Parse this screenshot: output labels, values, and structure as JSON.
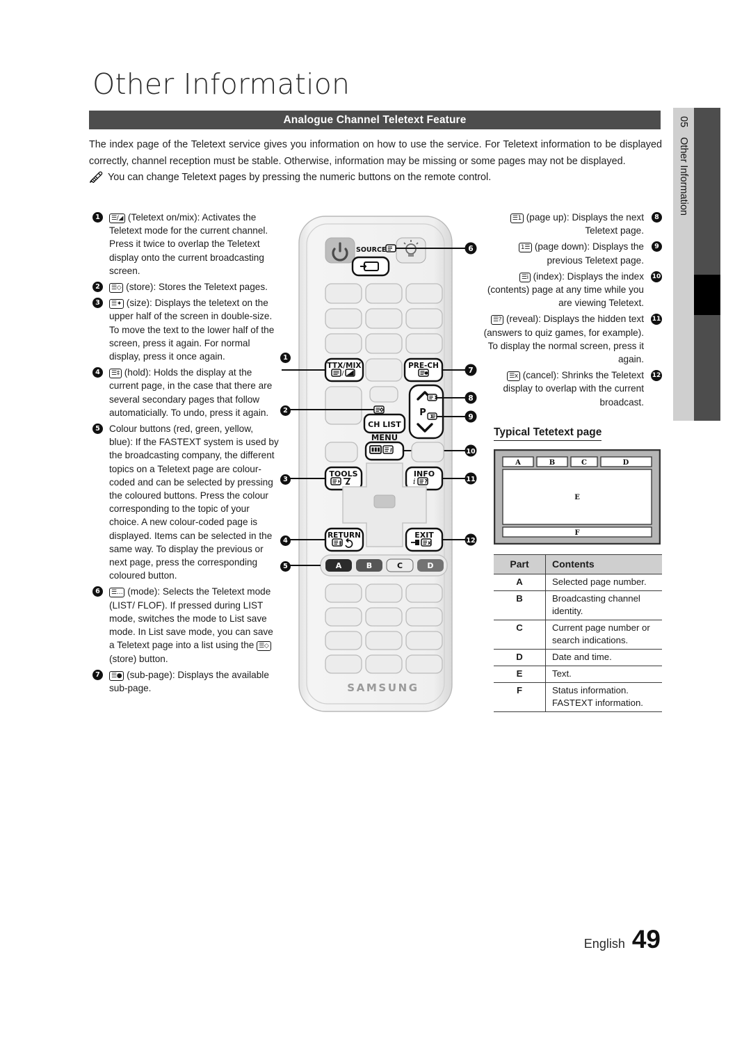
{
  "document": {
    "title": "Other Information",
    "section_header": "Analogue Channel Teletext Feature",
    "intro": "The index page of the Teletext service gives you information on how to use the service. For Teletext information to be displayed correctly, channel reception must be stable. Otherwise, information may be missing or some pages may not be displayed.",
    "note": "You can change Teletext pages by pressing the numeric buttons on the remote control.",
    "note_icon": "pencil-icon"
  },
  "left_column": [
    {
      "number": "1",
      "key": "☰/◢",
      "text": "(Teletext on/mix): Activates the Teletext mode for the current channel. Press it twice to overlap the Teletext display onto the current broadcasting screen."
    },
    {
      "number": "2",
      "key": "☰◇",
      "text": "(store): Stores the Teletext pages."
    },
    {
      "number": "3",
      "key": "☰✦",
      "text": "(size): Displays the teletext on the upper half of the screen in double-size. To move the text to the lower half of the screen, press it again. For normal display, press it once again."
    },
    {
      "number": "4",
      "key": "☰‡",
      "text": "(hold): Holds the display at the current page, in the case that there are several secondary pages that follow automaticially. To undo, press it again."
    },
    {
      "number": "5",
      "key": "",
      "text": "Colour buttons (red, green, yellow, blue): If the FASTEXT system is used by the broadcasting company, the different topics on a Teletext page are colour-coded and can be selected by pressing the coloured buttons. Press the colour corresponding to the topic of your choice. A new colour-coded page is displayed. Items can be selected in the same way. To display the previous or next page, press the corresponding coloured button."
    },
    {
      "number": "6",
      "key": "☰…",
      "text": "(mode): Selects the Teletext mode (LIST/ FLOF).",
      "text2_pre": "If pressed during LIST mode, switches the mode to List save mode. In List save mode, you can save a Teletext page into a list using the ",
      "text2_key": "☰◇",
      "text2_post": "(store) button."
    },
    {
      "number": "7",
      "key": "☰●",
      "text": "(sub-page): Displays the available sub-page."
    }
  ],
  "right_column": [
    {
      "number": "8",
      "key": "☰1",
      "text": "(page up): Displays the next Teletext page."
    },
    {
      "number": "9",
      "key": "1☰",
      "text": "(page down): Displays the previous Teletext page."
    },
    {
      "number": "10",
      "key": "☰i",
      "text": "(index): Displays the index (contents) page at any time while you are viewing Teletext."
    },
    {
      "number": "11",
      "key": "☰?",
      "text": "(reveal): Displays the hidden text (answers to quiz games, for example). To display the normal screen, press it again."
    },
    {
      "number": "12",
      "key": "☰x",
      "text": "(cancel): Shrinks the Teletext display to overlap with the current broadcast."
    }
  ],
  "remote": {
    "brand": "SAMSUNG",
    "buttons": {
      "source_label": "SOURCE",
      "ttxmix": "TTX/MIX",
      "prech": "PRE-CH",
      "chlist": "CH LIST",
      "menu": "MENU",
      "tools": "TOOLS",
      "info": "INFO",
      "return": "RETURN",
      "exit": "EXIT",
      "p_label": "P",
      "colour_a": "A",
      "colour_b": "B",
      "colour_c": "C",
      "colour_d": "D"
    },
    "callouts_left": [
      "1",
      "2",
      "3",
      "4",
      "5"
    ],
    "callouts_right": [
      "6",
      "7",
      "8",
      "9",
      "10",
      "11",
      "12"
    ]
  },
  "teletext_page": {
    "title": "Typical Tetetext page",
    "regions": [
      "A",
      "B",
      "C",
      "D",
      "E",
      "F"
    ]
  },
  "table": {
    "headers": [
      "Part",
      "Contents"
    ],
    "rows": [
      {
        "part": "A",
        "contents": "Selected page number."
      },
      {
        "part": "B",
        "contents": "Broadcasting channel identity."
      },
      {
        "part": "C",
        "contents": "Current page number or search indications."
      },
      {
        "part": "D",
        "contents": "Date and time."
      },
      {
        "part": "E",
        "contents": "Text."
      },
      {
        "part": "F",
        "contents": "Status information. FASTEXT information."
      }
    ]
  },
  "side_tab": {
    "chapter_number": "05",
    "chapter_title": "Other Information"
  },
  "footer": {
    "language": "English",
    "page_number": "49"
  },
  "colors": {
    "header_bar": "#4d4d4d",
    "side_tab_bg": "#cfcfcf",
    "side_bar": "#4d4d4d",
    "side_bar_active": "#000000",
    "table_header_bg": "#cfcfcf"
  }
}
